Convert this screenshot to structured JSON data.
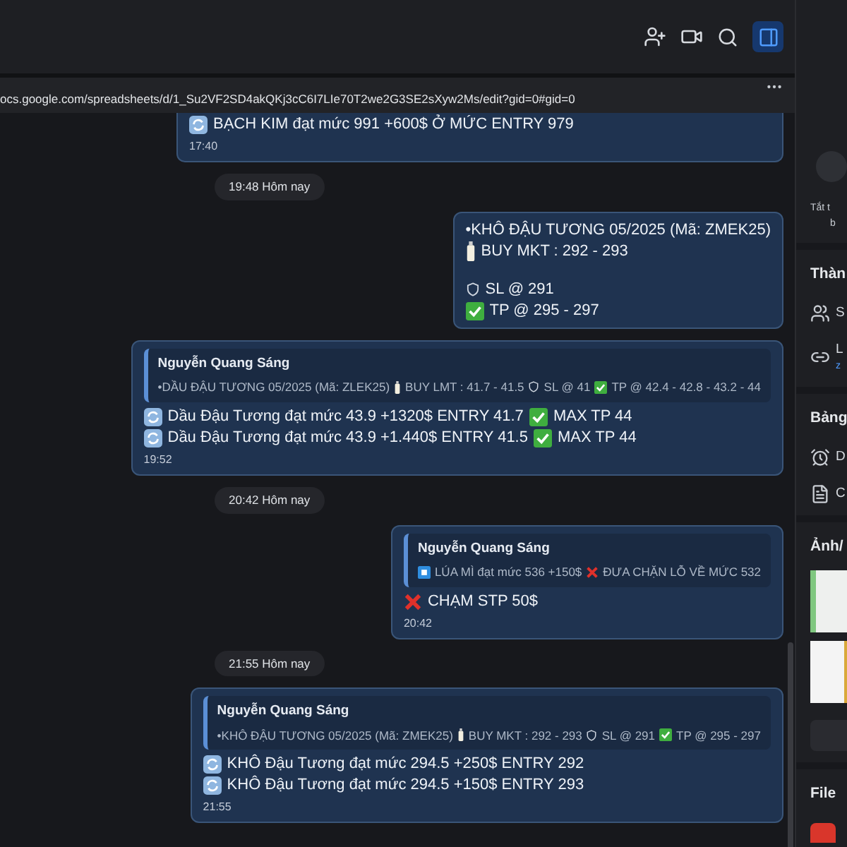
{
  "header": {
    "panel_toggle": {
      "selected": true
    }
  },
  "link_preview": {
    "url": "ocs.google.com/spreadsheets/d/1_Su2VF2SD4akQKj3cC6I7LIe70T2we2G3SE2sXyw2Ms/edit?gid=0#gid=0"
  },
  "messages": [
    {
      "kind": "message",
      "lines": [
        {
          "kind": "text",
          "segments": [
            {
              "kind": "sync"
            },
            {
              "kind": "text",
              "text": "BẠCH KIM đạt mức 991  +600$ Ở MỨC ENTRY 979"
            }
          ]
        }
      ],
      "time": "17:40",
      "cut_top": true
    },
    {
      "kind": "time",
      "text": "19:48 Hôm nay"
    },
    {
      "kind": "message",
      "lines": [
        {
          "kind": "text",
          "segments": [
            {
              "kind": "text",
              "text": "•KHÔ ĐẬU TƯƠNG 05/2025 (Mã: ZMEK25)"
            }
          ]
        },
        {
          "kind": "text",
          "segments": [
            {
              "kind": "bottle"
            },
            {
              "kind": "text",
              "text": "BUY MKT : 292 - 293"
            }
          ]
        },
        {
          "kind": "blank"
        },
        {
          "kind": "text",
          "segments": [
            {
              "kind": "shield"
            },
            {
              "kind": "text",
              "text": "SL @ 291"
            }
          ]
        },
        {
          "kind": "text",
          "segments": [
            {
              "kind": "check"
            },
            {
              "kind": "text",
              "text": "TP @  295 - 297"
            }
          ]
        }
      ]
    },
    {
      "kind": "message",
      "quote": {
        "author": "Nguyễn Quang Sáng",
        "segments": [
          {
            "kind": "text",
            "text": "•DẦU ĐẬU TƯƠNG 05/2025 (Mã: ZLEK25)"
          },
          {
            "kind": "bottle"
          },
          {
            "kind": "text",
            "text": "BUY LMT : 41.7 - 41.5"
          },
          {
            "kind": "shield"
          },
          {
            "kind": "text",
            "text": "SL @ 41"
          },
          {
            "kind": "check"
          },
          {
            "kind": "text",
            "text": "TP @ 42.4 - 42.8 - 43.2 - 44"
          }
        ]
      },
      "lines": [
        {
          "kind": "text",
          "segments": [
            {
              "kind": "sync"
            },
            {
              "kind": "text",
              "text": "Dầu Đậu Tương đạt mức 43.9  +1320$ ENTRY 41.7"
            },
            {
              "kind": "check"
            },
            {
              "kind": "text",
              "text": "MAX TP 44"
            }
          ]
        },
        {
          "kind": "text",
          "segments": [
            {
              "kind": "sync"
            },
            {
              "kind": "text",
              "text": "Dầu Đậu Tương đạt mức 43.9 +1.440$ ENTRY 41.5"
            },
            {
              "kind": "check"
            },
            {
              "kind": "text",
              "text": "MAX TP 44"
            }
          ]
        }
      ],
      "time": "19:52"
    },
    {
      "kind": "time",
      "text": "20:42 Hôm nay"
    },
    {
      "kind": "message",
      "quote": {
        "author": "Nguyễn Quang Sáng",
        "segments": [
          {
            "kind": "square"
          },
          {
            "kind": "text",
            "text": "LÚA MÌ đạt mức 536 +150$"
          },
          {
            "kind": "cross"
          },
          {
            "kind": "text",
            "text": "ĐƯA CHẶN LỖ VỀ MỨC 532"
          }
        ]
      },
      "lines": [
        {
          "kind": "text",
          "segments": [
            {
              "kind": "cross"
            },
            {
              "kind": "text",
              "text": "CHẠM STP 50$"
            }
          ]
        }
      ],
      "time": "20:42"
    },
    {
      "kind": "time",
      "text": "21:55 Hôm nay"
    },
    {
      "kind": "message",
      "quote": {
        "author": "Nguyễn Quang Sáng",
        "segments": [
          {
            "kind": "text",
            "text": "•KHÔ ĐẬU TƯƠNG 05/2025 (Mã: ZMEK25)"
          },
          {
            "kind": "bottle"
          },
          {
            "kind": "text",
            "text": "BUY MKT : 292 - 293"
          },
          {
            "kind": "shield"
          },
          {
            "kind": "text",
            "text": "SL @ 291"
          },
          {
            "kind": "check"
          },
          {
            "kind": "text",
            "text": "TP @ 295 - 297"
          }
        ]
      },
      "lines": [
        {
          "kind": "text",
          "segments": [
            {
              "kind": "sync"
            },
            {
              "kind": "text",
              "text": "KHÔ Đậu Tương đạt mức 294.5  +250$ ENTRY 292"
            }
          ]
        },
        {
          "kind": "text",
          "segments": [
            {
              "kind": "sync"
            },
            {
              "kind": "text",
              "text": "KHÔ Đậu Tương đạt mức 294.5 +150$ ENTRY 293"
            }
          ]
        }
      ],
      "time": "21:55"
    }
  ],
  "side_panel": {
    "notice": [
      "Tắt t",
      "b"
    ],
    "sections": [
      {
        "kind": "list",
        "title": "Thàn",
        "items": [
          {
            "kind": "people",
            "text": "S"
          },
          {
            "kind": "link",
            "text": "L",
            "subtext": "z"
          }
        ]
      },
      {
        "kind": "list",
        "title": "Bảng",
        "items": [
          {
            "kind": "alarm",
            "text": "D"
          },
          {
            "kind": "document",
            "text": "C"
          }
        ]
      },
      {
        "kind": "media",
        "title": "Ảnh/"
      },
      {
        "kind": "files",
        "title": "File"
      }
    ]
  }
}
